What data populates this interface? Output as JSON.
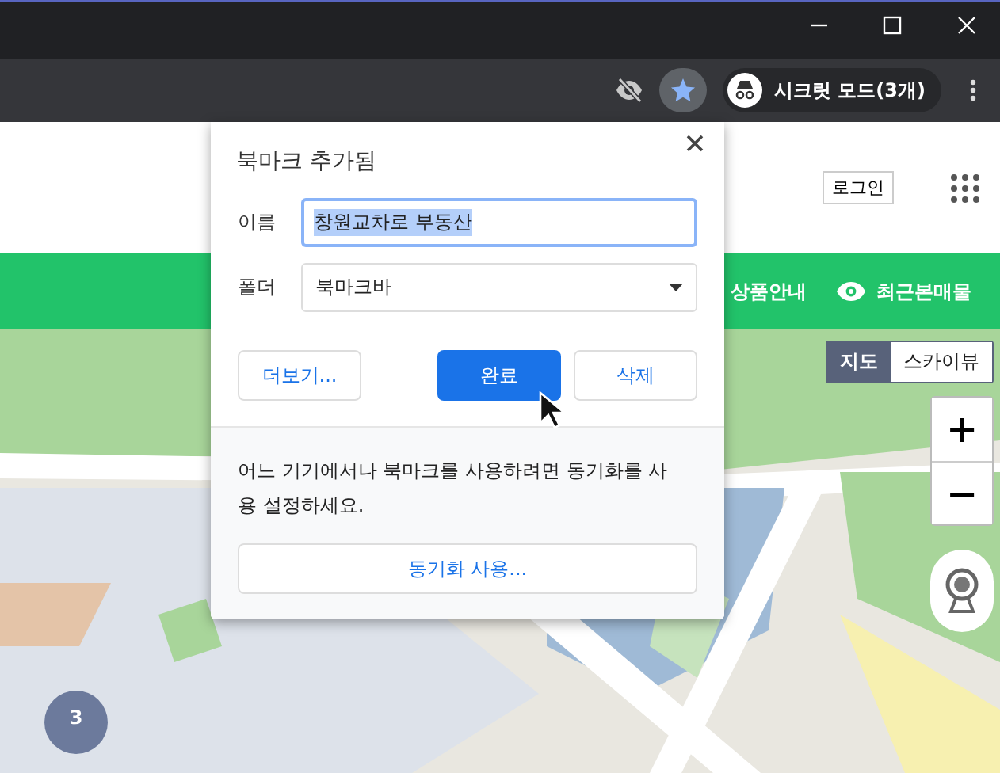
{
  "toolbar": {
    "bookmarked": true,
    "incognito_label": "시크릿 모드(3개)"
  },
  "header": {
    "login_button": "로그인"
  },
  "nav": {
    "items": [
      {
        "label": "상품안내",
        "kind": "text"
      },
      {
        "label": "최근본매물",
        "kind": "eye"
      }
    ]
  },
  "map": {
    "kind": "picture",
    "type_toggle": [
      {
        "label": "지도",
        "selected": true
      },
      {
        "label": "스카이뷰",
        "selected": false
      }
    ],
    "zoom_in": "+",
    "zoom_out": "−",
    "cluster_marker": "3"
  },
  "dialog": {
    "title": "북마크 추가됨",
    "fields": [
      {
        "label": "이름",
        "kind": "input",
        "value": "창원교차로 부동산",
        "selected": true
      },
      {
        "label": "폴더",
        "kind": "select",
        "value": "북마크바",
        "selected": false
      }
    ],
    "buttons": [
      {
        "label": "더보기...",
        "kind": "secondary"
      },
      {
        "label": "완료",
        "kind": "primary"
      },
      {
        "label": "삭제",
        "kind": "secondary"
      }
    ],
    "sync_message": "어느 기기에서나 북마크를 사용하려면 동기화를 사용 설정하세요.",
    "sync_button": "동기화 사용..."
  }
}
